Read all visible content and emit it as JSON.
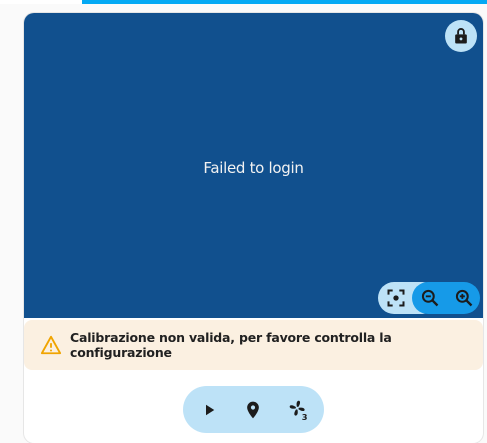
{
  "map": {
    "message": "Failed to login",
    "lock_icon": "lock-open-icon",
    "zoom_controls": [
      "focus-center-icon",
      "zoom-out-icon",
      "zoom-in-icon"
    ]
  },
  "warning": {
    "icon": "alert-triangle-icon",
    "color": "#f0a400",
    "text": "Calibrazione non valida, per favore controlla la configurazione"
  },
  "controls": {
    "buttons": [
      "play-icon",
      "map-marker-icon",
      "fan-speed-3-icon"
    ]
  },
  "colors": {
    "accent": "#03a9f4",
    "map_background": "#11508e",
    "button_light": "#bde2f7",
    "button_active": "#169ae8",
    "warning_background": "#fbf0e1"
  }
}
